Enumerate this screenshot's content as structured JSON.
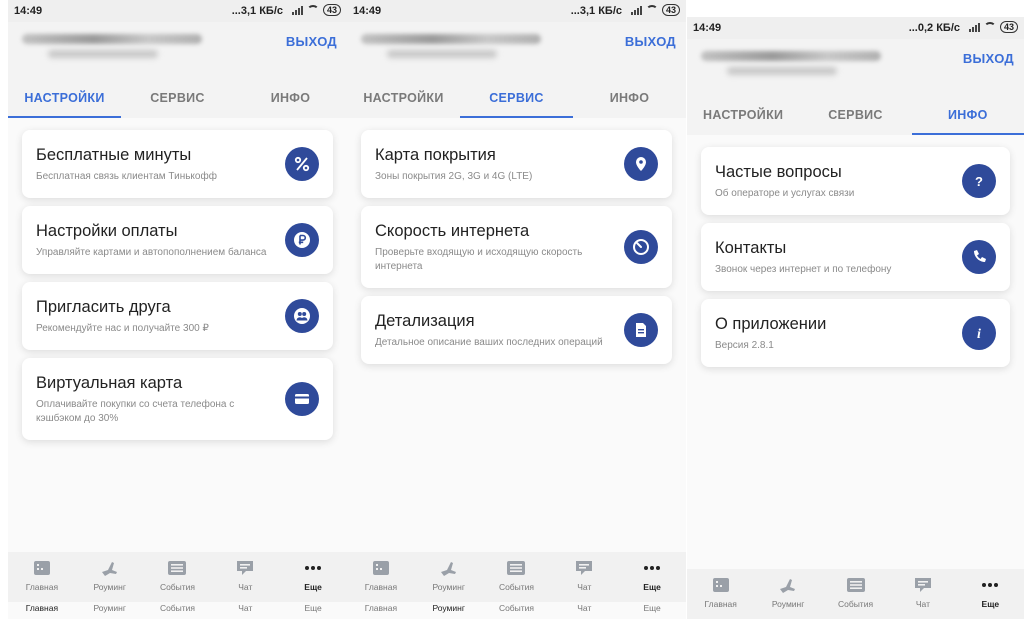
{
  "statusbar": {
    "time": "14:49",
    "net": [
      "...3,1 КБ/с",
      "...3,1 КБ/с",
      "...0,2 КБ/с"
    ],
    "battery": "43"
  },
  "header": {
    "exit_label": "ВЫХОД"
  },
  "tabs": [
    "НАСТРОЙКИ",
    "СЕРВИС",
    "ИНФО"
  ],
  "screens": [
    {
      "cards": [
        {
          "title": "Бесплатные минуты",
          "subtitle": "Бесплатная связь клиентам Тинькофф",
          "icon": "percent-icon"
        },
        {
          "title": "Настройки оплаты",
          "subtitle": "Управляйте картами и автопополнением баланса",
          "icon": "ruble-icon"
        },
        {
          "title": "Пригласить друга",
          "subtitle": "Рекомендуйте нас и получайте 300 ₽",
          "icon": "friends-icon"
        },
        {
          "title": "Виртуальная карта",
          "subtitle": "Оплачивайте покупки со счета телефона с кэшбэком до 30%",
          "icon": "card-icon"
        }
      ]
    },
    {
      "cards": [
        {
          "title": "Карта покрытия",
          "subtitle": "Зоны покрытия 2G, 3G и 4G (LTE)",
          "icon": "location-pin-icon"
        },
        {
          "title": "Скорость интернета",
          "subtitle": "Проверьте входящую и исходящую скорость интернета",
          "icon": "speedometer-icon"
        },
        {
          "title": "Детализация",
          "subtitle": "Детальное описание ваших последних операций",
          "icon": "document-icon"
        }
      ]
    },
    {
      "cards": [
        {
          "title": "Частые вопросы",
          "subtitle": "Об операторе и услугах связи",
          "icon": "question-icon"
        },
        {
          "title": "Контакты",
          "subtitle": "Звонок через интернет и по телефону",
          "icon": "phone-icon"
        },
        {
          "title": "О приложении",
          "subtitle": "Версия 2.8.1",
          "icon": "info-icon"
        }
      ]
    }
  ],
  "bottomnav": [
    "Главная",
    "Роуминг",
    "События",
    "Чат",
    "Еще"
  ],
  "colors": {
    "accent": "#3b6ed8",
    "icon_bg": "#2f4a9a"
  }
}
